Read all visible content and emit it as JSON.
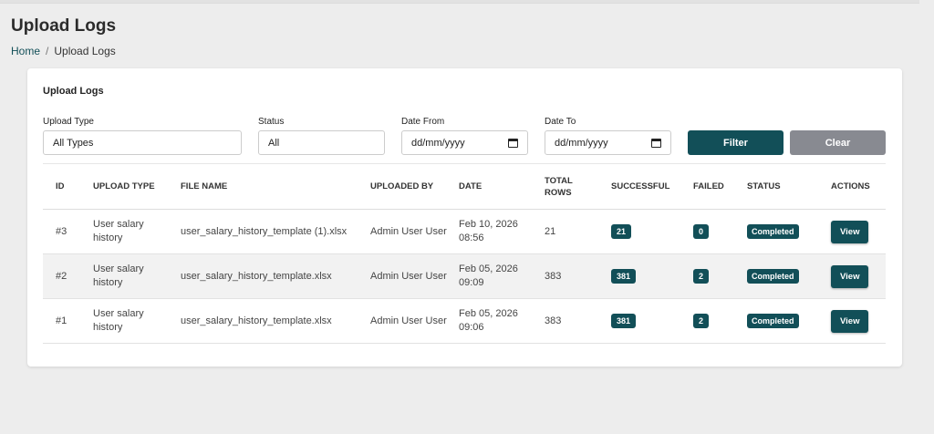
{
  "page": {
    "title": "Upload Logs"
  },
  "breadcrumb": {
    "home": "Home",
    "separator": "/",
    "current": "Upload Logs"
  },
  "card": {
    "title": "Upload Logs"
  },
  "filters": {
    "upload_type": {
      "label": "Upload Type",
      "value": "All Types"
    },
    "status": {
      "label": "Status",
      "value": "All"
    },
    "date_from": {
      "label": "Date From",
      "placeholder": "dd/mm/yyyy"
    },
    "date_to": {
      "label": "Date To",
      "placeholder": "dd/mm/yyyy"
    },
    "filter_button": "Filter",
    "clear_button": "Clear"
  },
  "table": {
    "headers": {
      "id": "ID",
      "upload_type": "UPLOAD TYPE",
      "file_name": "FILE NAME",
      "uploaded_by": "UPLOADED BY",
      "date": "DATE",
      "total_rows": "TOTAL ROWS",
      "successful": "SUCCESSFUL",
      "failed": "FAILED",
      "status": "STATUS",
      "actions": "ACTIONS"
    },
    "rows": [
      {
        "id": "#3",
        "upload_type": "User salary history",
        "file_name": "user_salary_history_template (1).xlsx",
        "uploaded_by": "Admin User User",
        "date": "Feb 10, 2026 08:56",
        "total_rows": "21",
        "successful": "21",
        "failed": "0",
        "status": "Completed",
        "action": "View"
      },
      {
        "id": "#2",
        "upload_type": "User salary history",
        "file_name": "user_salary_history_template.xlsx",
        "uploaded_by": "Admin User User",
        "date": "Feb 05, 2026 09:09",
        "total_rows": "383",
        "successful": "381",
        "failed": "2",
        "status": "Completed",
        "action": "View"
      },
      {
        "id": "#1",
        "upload_type": "User salary history",
        "file_name": "user_salary_history_template.xlsx",
        "uploaded_by": "Admin User User",
        "date": "Feb 05, 2026 09:06",
        "total_rows": "383",
        "successful": "381",
        "failed": "2",
        "status": "Completed",
        "action": "View"
      }
    ]
  },
  "colors": {
    "primary": "#124f58",
    "secondary": "#888a91",
    "background": "#ededed"
  }
}
